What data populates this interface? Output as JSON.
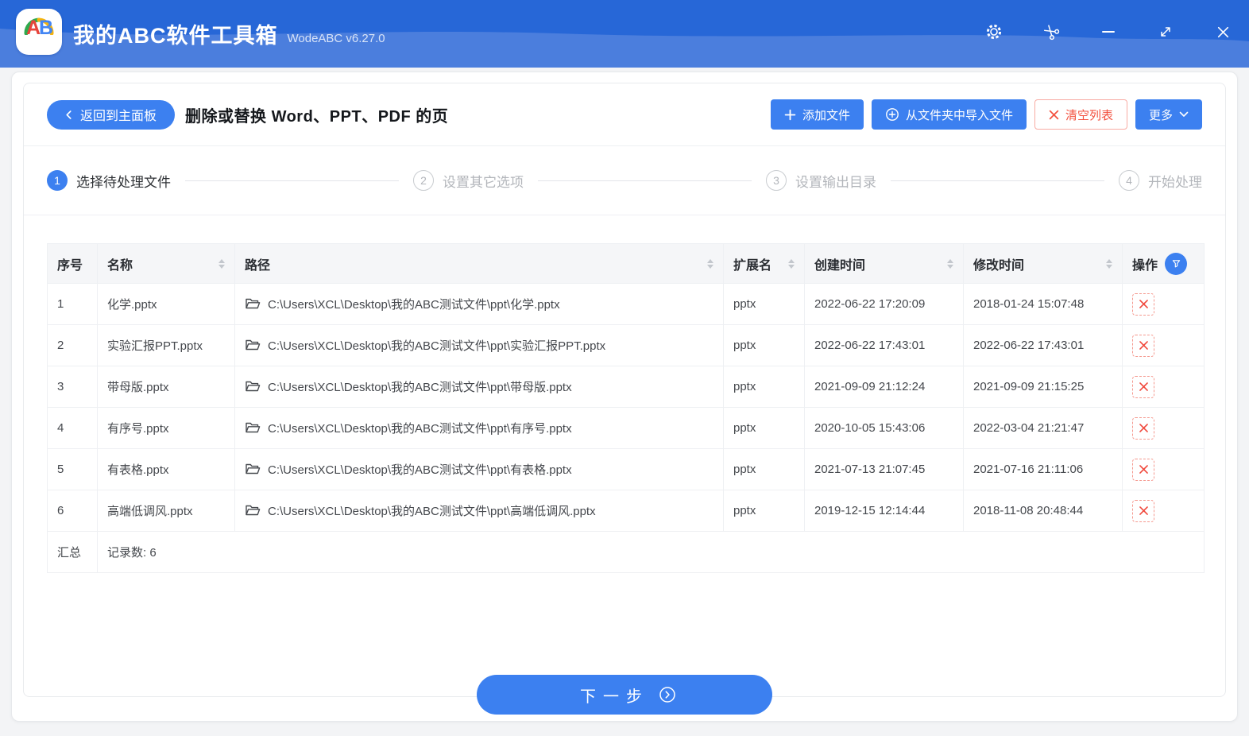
{
  "colors": {
    "accent": "#3c80f0",
    "danger": "#f0483c"
  },
  "titlebar": {
    "logo_text_a": "A",
    "logo_text_b": "B",
    "app_title": "我的ABC软件工具箱",
    "version": "WodeABC v6.27.0"
  },
  "header": {
    "back_label": "返回到主面板",
    "page_title": "删除或替换 Word、PPT、PDF 的页",
    "add_files_label": "添加文件",
    "import_folder_label": "从文件夹中导入文件",
    "clear_list_label": "清空列表",
    "more_label": "更多"
  },
  "steps": [
    {
      "num": "1",
      "label": "选择待处理文件",
      "active": true
    },
    {
      "num": "2",
      "label": "设置其它选项",
      "active": false
    },
    {
      "num": "3",
      "label": "设置输出目录",
      "active": false
    },
    {
      "num": "4",
      "label": "开始处理",
      "active": false
    }
  ],
  "table": {
    "columns": [
      {
        "label": "序号",
        "sortable": false,
        "filter": false
      },
      {
        "label": "名称",
        "sortable": true,
        "filter": false
      },
      {
        "label": "路径",
        "sortable": true,
        "filter": false
      },
      {
        "label": "扩展名",
        "sortable": true,
        "filter": false
      },
      {
        "label": "创建时间",
        "sortable": true,
        "filter": false
      },
      {
        "label": "修改时间",
        "sortable": true,
        "filter": false
      },
      {
        "label": "操作",
        "sortable": false,
        "filter": true
      }
    ],
    "rows": [
      {
        "index": "1",
        "name": "化学.pptx",
        "path": "C:\\Users\\XCL\\Desktop\\我的ABC测试文件\\ppt\\化学.pptx",
        "ext": "pptx",
        "created": "2022-06-22 17:20:09",
        "modified": "2018-01-24 15:07:48"
      },
      {
        "index": "2",
        "name": "实验汇报PPT.pptx",
        "path": "C:\\Users\\XCL\\Desktop\\我的ABC测试文件\\ppt\\实验汇报PPT.pptx",
        "ext": "pptx",
        "created": "2022-06-22 17:43:01",
        "modified": "2022-06-22 17:43:01"
      },
      {
        "index": "3",
        "name": "带母版.pptx",
        "path": "C:\\Users\\XCL\\Desktop\\我的ABC测试文件\\ppt\\带母版.pptx",
        "ext": "pptx",
        "created": "2021-09-09 21:12:24",
        "modified": "2021-09-09 21:15:25"
      },
      {
        "index": "4",
        "name": "有序号.pptx",
        "path": "C:\\Users\\XCL\\Desktop\\我的ABC测试文件\\ppt\\有序号.pptx",
        "ext": "pptx",
        "created": "2020-10-05 15:43:06",
        "modified": "2022-03-04 21:21:47"
      },
      {
        "index": "5",
        "name": "有表格.pptx",
        "path": "C:\\Users\\XCL\\Desktop\\我的ABC测试文件\\ppt\\有表格.pptx",
        "ext": "pptx",
        "created": "2021-07-13 21:07:45",
        "modified": "2021-07-16 21:11:06"
      },
      {
        "index": "6",
        "name": "高端低调风.pptx",
        "path": "C:\\Users\\XCL\\Desktop\\我的ABC测试文件\\ppt\\高端低调风.pptx",
        "ext": "pptx",
        "created": "2019-12-15 12:14:44",
        "modified": "2018-11-08 20:48:44"
      }
    ],
    "summary_label": "汇总",
    "summary_text": "记录数: 6"
  },
  "footer": {
    "next_label": "下一步"
  }
}
